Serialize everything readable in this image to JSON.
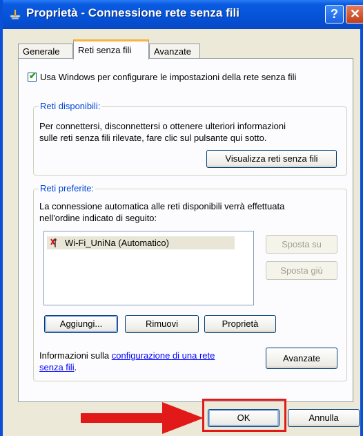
{
  "window": {
    "title": "Proprietà - Connessione rete senza fili",
    "help_glyph": "?",
    "close_glyph": "✕"
  },
  "tabs": [
    {
      "label": "Generale"
    },
    {
      "label": "Reti senza fili"
    },
    {
      "label": "Avanzate"
    }
  ],
  "checkbox": {
    "label": "Usa Windows per configurare le impostazioni della rete senza fili",
    "checked": true
  },
  "available": {
    "label": "Reti disponibili:",
    "line1": "Per connettersi, disconnettersi o ottenere ulteriori informazioni",
    "line2": "sulle reti senza fili rilevate, fare clic sul pulsante qui sotto.",
    "button": "Visualizza reti senza fili"
  },
  "preferred": {
    "label": "Reti preferite:",
    "line1": "La connessione automatica alle reti disponibili verrà effettuata",
    "line2": "nell'ordine indicato di seguito:",
    "networks": [
      {
        "name": "Wi-Fi_UniNa (Automatico)"
      }
    ],
    "move_up": "Sposta su",
    "move_down": "Sposta giù",
    "add": "Aggiungi...",
    "remove": "Rimuovi",
    "properties": "Proprietà"
  },
  "info": {
    "prefix": "Informazioni sulla ",
    "link1": "configurazione di una rete",
    "link2": "senza fili",
    "suffix": ".",
    "button": "Avanzate"
  },
  "footer": {
    "ok": "OK",
    "cancel": "Annulla"
  },
  "colors": {
    "titlebar": "#0452d8",
    "accent_tab": "#f8b33c",
    "group_label": "#0046d5",
    "highlight": "#e11919"
  }
}
